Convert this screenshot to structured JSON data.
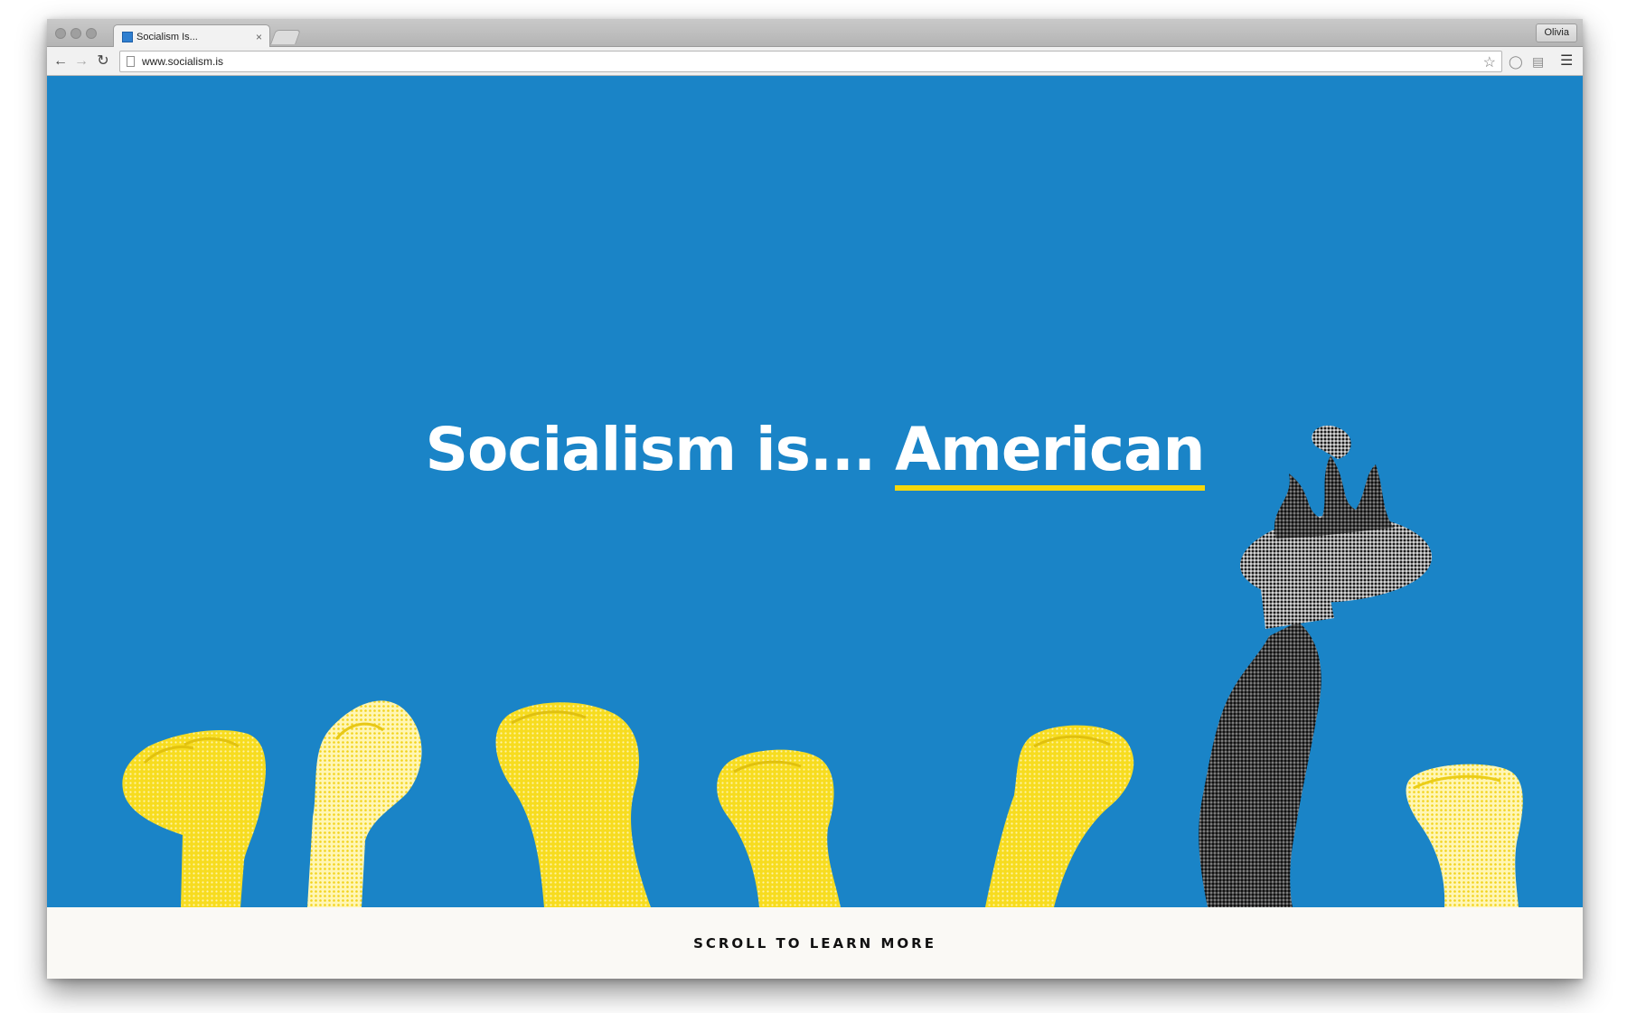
{
  "browser": {
    "tab_title": "Socialism Is...",
    "tab_close": "×",
    "profile_name": "Olivia",
    "url": "www.socialism.is"
  },
  "page": {
    "headline_prefix": "Socialism is...",
    "headline_accent": "American",
    "cta": "SCROLL TO LEARN MORE"
  },
  "colors": {
    "hero_background": "#1a84c7",
    "accent_yellow": "#f5d70c",
    "footer_background": "#faf9f5"
  },
  "icons": {
    "back": "arrow-left",
    "forward": "arrow-right",
    "reload": "reload",
    "bookmark": "star",
    "menu": "hamburger"
  }
}
